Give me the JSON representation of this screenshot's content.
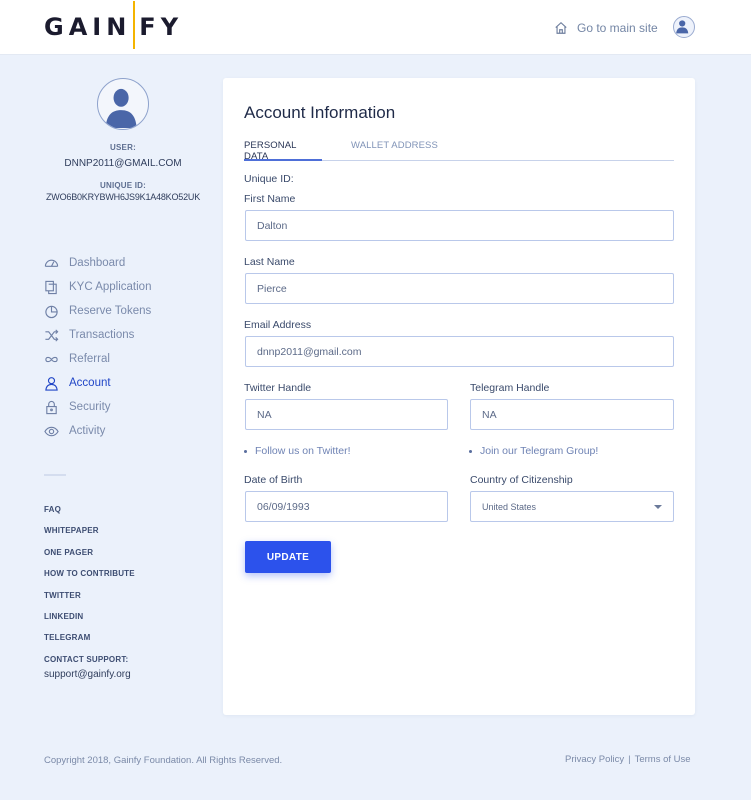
{
  "header": {
    "logo_left": "GAIN",
    "logo_right": "FY",
    "main_site_link": "Go to main site"
  },
  "sidebar": {
    "user_label": "USER:",
    "user_email": "DNNP2011@GMAIL.COM",
    "unique_id_label": "UNIQUE ID:",
    "unique_id_value": "ZWO6B0KRYBWH6JS9K1A48KO52UK",
    "nav": [
      {
        "label": "Dashboard",
        "icon": "dashboard-icon",
        "active": false
      },
      {
        "label": "KYC Application",
        "icon": "documents-icon",
        "active": false
      },
      {
        "label": "Reserve Tokens",
        "icon": "pie-chart-icon",
        "active": false
      },
      {
        "label": "Transactions",
        "icon": "shuffle-icon",
        "active": false
      },
      {
        "label": "Referral",
        "icon": "infinity-icon",
        "active": false
      },
      {
        "label": "Account",
        "icon": "user-icon",
        "active": true
      },
      {
        "label": "Security",
        "icon": "lock-icon",
        "active": false
      },
      {
        "label": "Activity",
        "icon": "eye-icon",
        "active": false
      }
    ],
    "links": [
      "FAQ",
      "WHITEPAPER",
      "ONE PAGER",
      "HOW TO CONTRIBUTE",
      "TWITTER",
      "LINKEDIN",
      "TELEGRAM"
    ],
    "contact_label": "CONTACT SUPPORT:",
    "contact_email": "support@gainfy.org"
  },
  "card": {
    "title": "Account Information",
    "tabs": [
      "PERSONAL DATA",
      "WALLET ADDRESS"
    ],
    "unique_id_label": "Unique ID:",
    "first_name_label": "First Name",
    "first_name_value": "Dalton",
    "last_name_label": "Last Name",
    "last_name_value": "Pierce",
    "email_label": "Email Address",
    "email_value": "dnnp2011@gmail.com",
    "twitter_label": "Twitter Handle",
    "twitter_value": "NA",
    "telegram_label": "Telegram Handle",
    "telegram_value": "NA",
    "twitter_link": "Follow us on Twitter!",
    "telegram_link": "Join our Telegram Group!",
    "dob_label": "Date of Birth",
    "dob_value": "06/09/1993",
    "country_label": "Country of Citizenship",
    "country_value": "United States",
    "update_button": "UPDATE"
  },
  "footer": {
    "copyright": "Copyright 2018, Gainfy Foundation. All Rights Reserved.",
    "privacy": "Privacy Policy",
    "separator": "|",
    "terms": "Terms of Use"
  },
  "colors": {
    "accent": "#2c52ec",
    "active_nav": "#2146c7",
    "logo_bar": "#f4b400",
    "background": "#ebf1fb"
  }
}
